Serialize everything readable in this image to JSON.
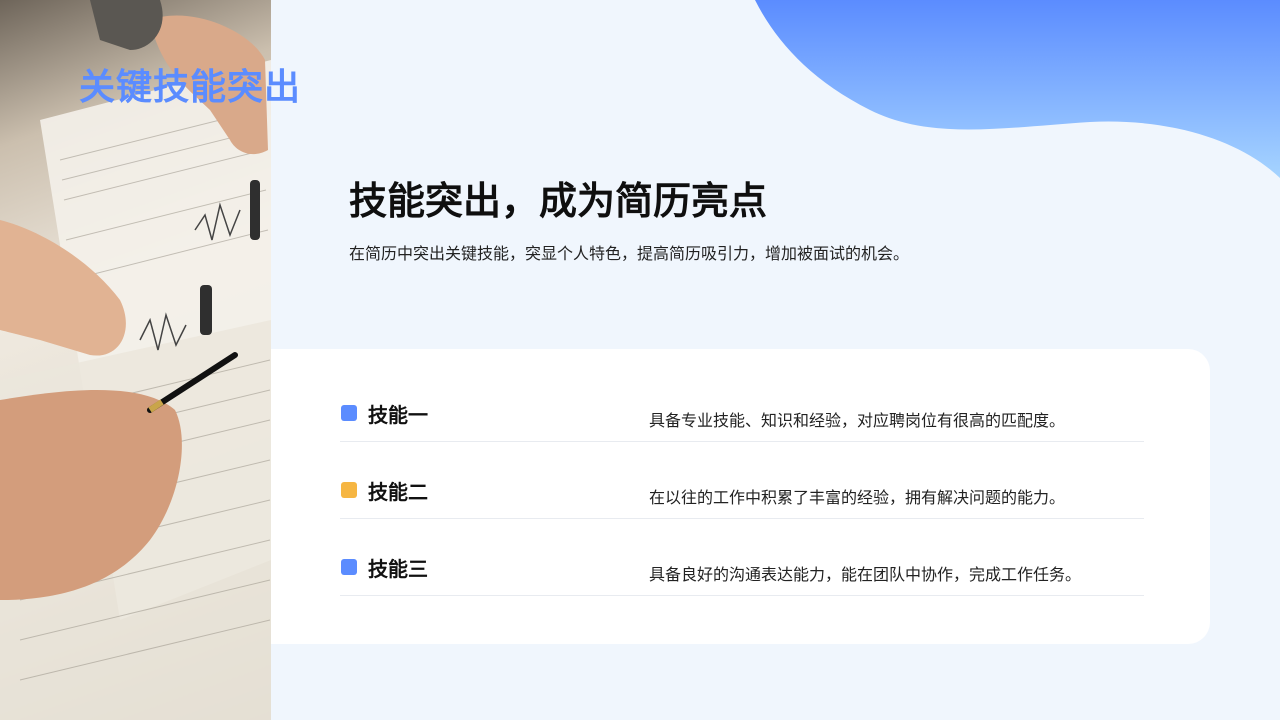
{
  "slide": {
    "top_title": "关键技能突出",
    "headline": "技能突出，成为简历亮点",
    "subtitle": "在简历中突出关键技能，突显个人特色，提高简历吸引力，增加被面试的机会。"
  },
  "skills": [
    {
      "name": "技能一",
      "description": "具备专业技能、知识和经验，对应聘岗位有很高的匹配度。",
      "color": "#5b8cff"
    },
    {
      "name": "技能二",
      "description": "在以往的工作中积累了丰富的经验，拥有解决问题的能力。",
      "color": "#f6b642"
    },
    {
      "name": "技能三",
      "description": "具备良好的沟通表达能力，能在团队中协作，完成工作任务。",
      "color": "#5b8cff"
    }
  ],
  "colors": {
    "accent_blue": "#5b8cff",
    "accent_orange": "#f6b642",
    "background": "#f0f6fd",
    "wave_top": "#5b8cff",
    "wave_bottom": "#a6d4ff"
  }
}
